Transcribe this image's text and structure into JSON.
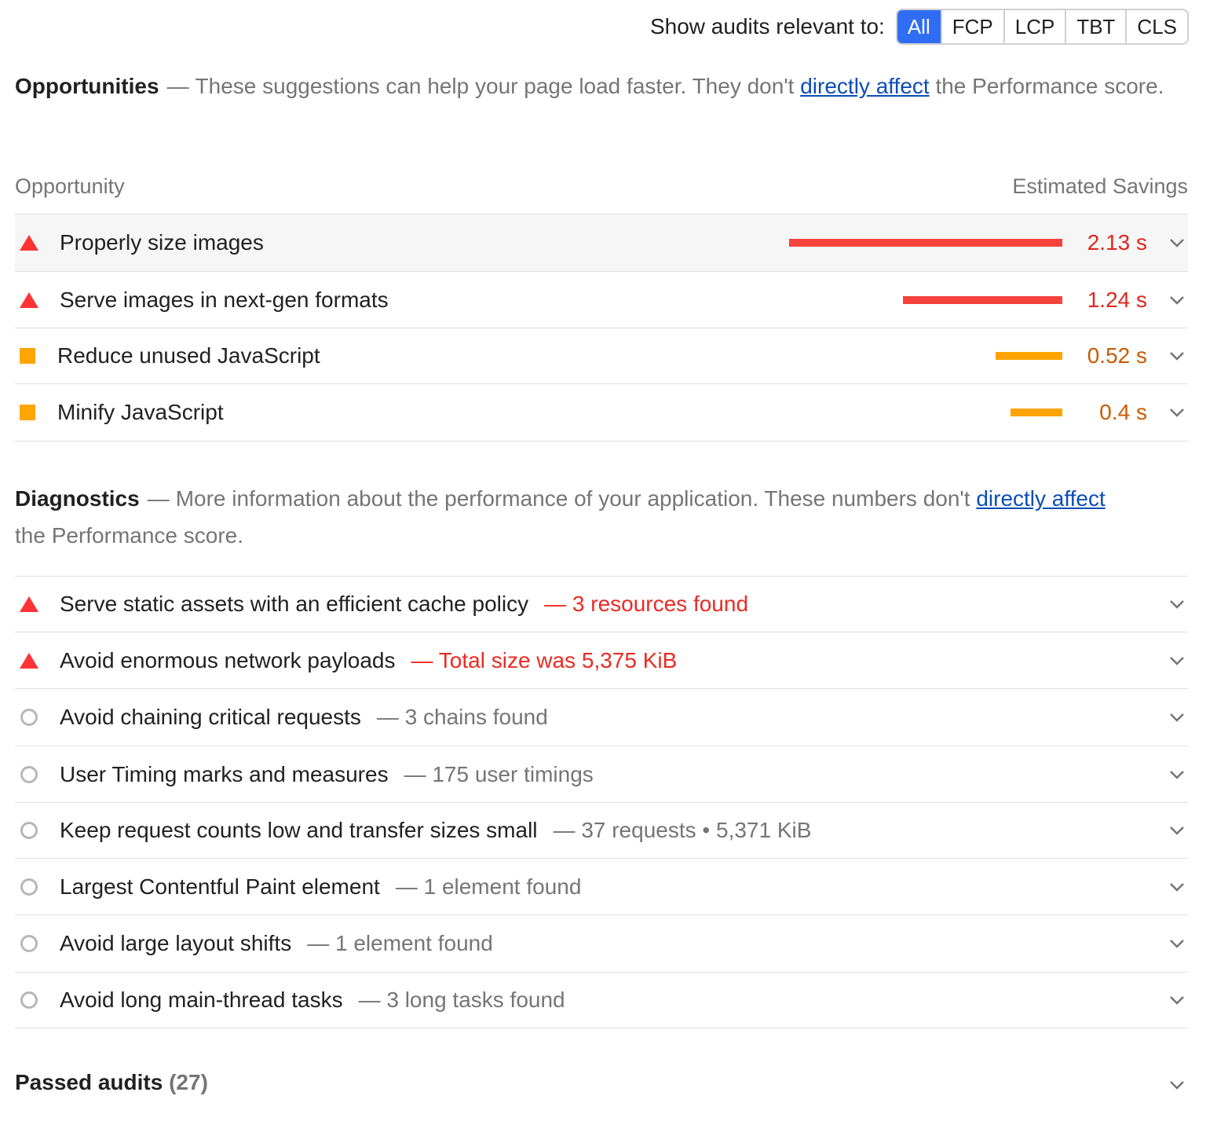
{
  "filter": {
    "label": "Show audits relevant to:",
    "options": [
      "All",
      "FCP",
      "LCP",
      "TBT",
      "CLS"
    ],
    "selected": "All",
    "accent_color": "#2f6df5"
  },
  "opportunities": {
    "title": "Opportunities",
    "dash": "—",
    "desc_before": "These suggestions can help your page load faster. They don't ",
    "link": "directly affect",
    "desc_after": " the Performance score.",
    "col_left": "Opportunity",
    "col_right": "Estimated Savings",
    "items": [
      {
        "title": "Properly size images",
        "savings": "2.13 s",
        "savings_seconds": 2.13,
        "severity": "fail",
        "icon": "triangle-icon"
      },
      {
        "title": "Serve images in next-gen formats",
        "savings": "1.24 s",
        "savings_seconds": 1.24,
        "severity": "fail",
        "icon": "triangle-icon"
      },
      {
        "title": "Reduce unused JavaScript",
        "savings": "0.52 s",
        "savings_seconds": 0.52,
        "severity": "average",
        "icon": "square-icon"
      },
      {
        "title": "Minify JavaScript",
        "savings": "0.4 s",
        "savings_seconds": 0.4,
        "severity": "average",
        "icon": "square-icon"
      }
    ]
  },
  "diagnostics": {
    "title": "Diagnostics",
    "dash": "—",
    "desc_before": "More information about the performance of your application. These numbers don't ",
    "link": "directly affect",
    "desc_after": " the Performance score.",
    "items": [
      {
        "title": "Serve static assets with an efficient cache policy",
        "detail": "3 resources found",
        "severity": "fail",
        "icon": "triangle-icon"
      },
      {
        "title": "Avoid enormous network payloads",
        "detail": "Total size was 5,375 KiB",
        "severity": "fail",
        "icon": "triangle-icon"
      },
      {
        "title": "Avoid chaining critical requests",
        "detail": "3 chains found",
        "severity": "info",
        "icon": "circle-icon"
      },
      {
        "title": "User Timing marks and measures",
        "detail": "175 user timings",
        "severity": "info",
        "icon": "circle-icon"
      },
      {
        "title": "Keep request counts low and transfer sizes small",
        "detail": "37 requests • 5,371 KiB",
        "severity": "info",
        "icon": "circle-icon"
      },
      {
        "title": "Largest Contentful Paint element",
        "detail": "1 element found",
        "severity": "info",
        "icon": "circle-icon"
      },
      {
        "title": "Avoid large layout shifts",
        "detail": "1 element found",
        "severity": "info",
        "icon": "circle-icon"
      },
      {
        "title": "Avoid long main-thread tasks",
        "detail": "3 long tasks found",
        "severity": "info",
        "icon": "circle-icon"
      }
    ]
  },
  "passed": {
    "label": "Passed audits",
    "count": "(27)"
  },
  "colors": {
    "fail": "#f33",
    "average": "#ffa400",
    "info": "#b7b7b7",
    "link": "#0b4db6"
  }
}
